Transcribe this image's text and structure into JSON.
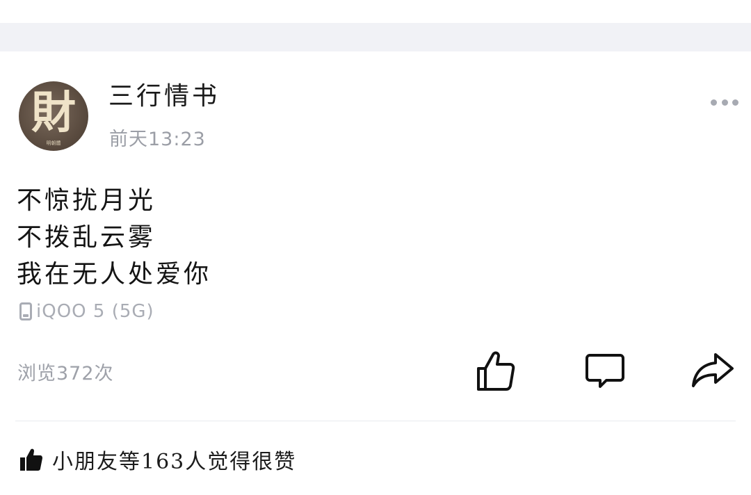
{
  "post": {
    "author_name": "三行情书",
    "avatar_char": "財",
    "avatar_seal": "明朝體",
    "time": "前天13:23",
    "content_lines": [
      "不惊扰月光",
      "不拨乱云雾",
      "我在无人处爱你"
    ],
    "device": "iQOO 5 (5G)",
    "views": "浏览372次",
    "likes_summary": "小朋友等163人觉得很赞"
  },
  "icons": {
    "more": "more-dots-icon",
    "device": "phone-icon",
    "like": "thumbs-up-icon",
    "comment": "comment-bubble-icon",
    "share": "share-arrow-icon",
    "likes_summary": "thumbs-up-filled-icon"
  },
  "colors": {
    "band": "#f1f2f6",
    "secondary_text": "#9b9ea6",
    "primary_text": "#1a1a1a",
    "icon_stroke": "#111111"
  }
}
